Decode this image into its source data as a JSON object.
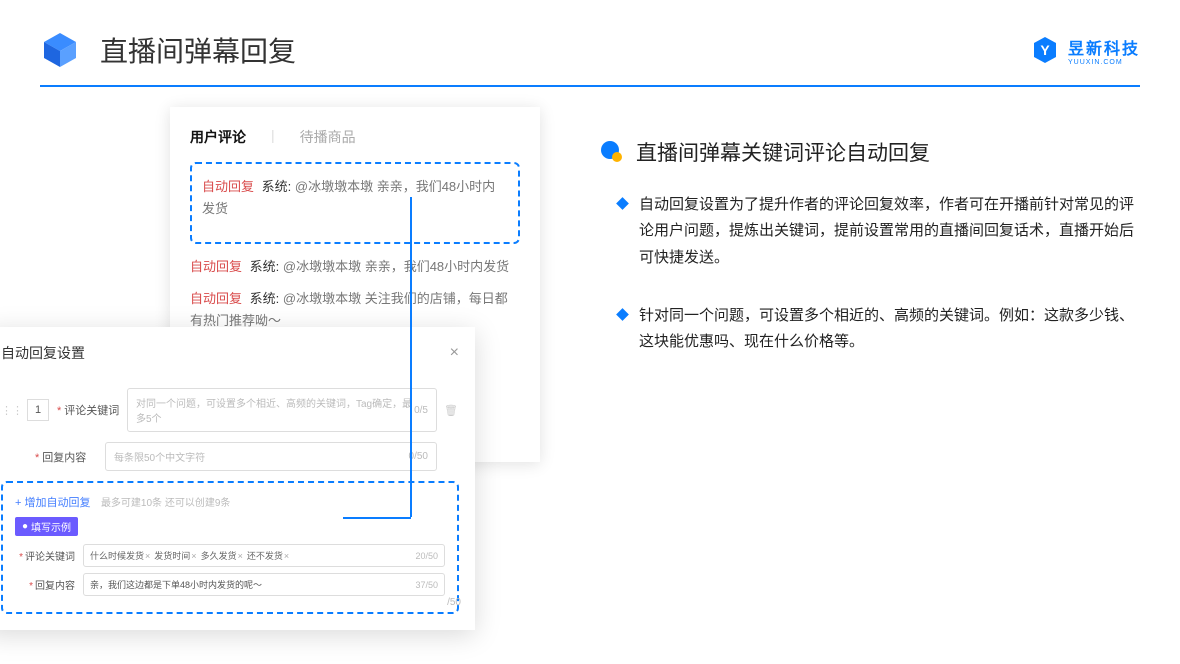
{
  "header": {
    "title": "直播间弹幕回复",
    "brand_text": "昱新科技",
    "brand_sub": "YUUXIN.COM"
  },
  "comments_card": {
    "tabs": {
      "active": "用户评论",
      "inactive": "待播商品"
    },
    "hl_tag": "自动回复",
    "hl_sys": "系统:",
    "hl_msg": "@冰墩墩本墩 亲亲，我们48小时内发货",
    "row2_tag": "自动回复",
    "row2_sys": "系统:",
    "row2_msg": "@冰墩墩本墩 亲亲，我们48小时内发货",
    "row3_tag": "自动回复",
    "row3_sys": "系统:",
    "row3_msg": "@冰墩墩本墩 关注我们的店铺，每日都有热门推荐呦～"
  },
  "modal": {
    "title": "自动回复设置",
    "index": "1",
    "f1_label": "评论关键词",
    "f1_placeholder": "对同一个问题，可设置多个相近、高频的关键词，Tag确定，最多5个",
    "f1_count": "0/5",
    "f2_label": "回复内容",
    "f2_placeholder": "每条限50个中文字符",
    "f2_count": "0/50",
    "add_link": "+ 增加自动回复",
    "add_hint": "最多可建10条 还可以创建9条",
    "example_badge": "填写示例",
    "ex1_label": "评论关键词",
    "ex1_tags": [
      "什么时候发货",
      "发货时间",
      "多久发货",
      "还不发货"
    ],
    "ex1_count": "20/50",
    "ex2_label": "回复内容",
    "ex2_text": "亲，我们这边都是下单48小时内发货的呢～",
    "ex2_count": "37/50",
    "outer_count": "/50"
  },
  "right": {
    "section_title": "直播间弹幕关键词评论自动回复",
    "bullets": [
      "自动回复设置为了提升作者的评论回复效率，作者可在开播前针对常见的评论用户问题，提炼出关键词，提前设置常用的直播间回复话术，直播开始后可快捷发送。",
      "针对同一个问题，可设置多个相近的、高频的关键词。例如：这款多少钱、这块能优惠吗、现在什么价格等。"
    ]
  }
}
